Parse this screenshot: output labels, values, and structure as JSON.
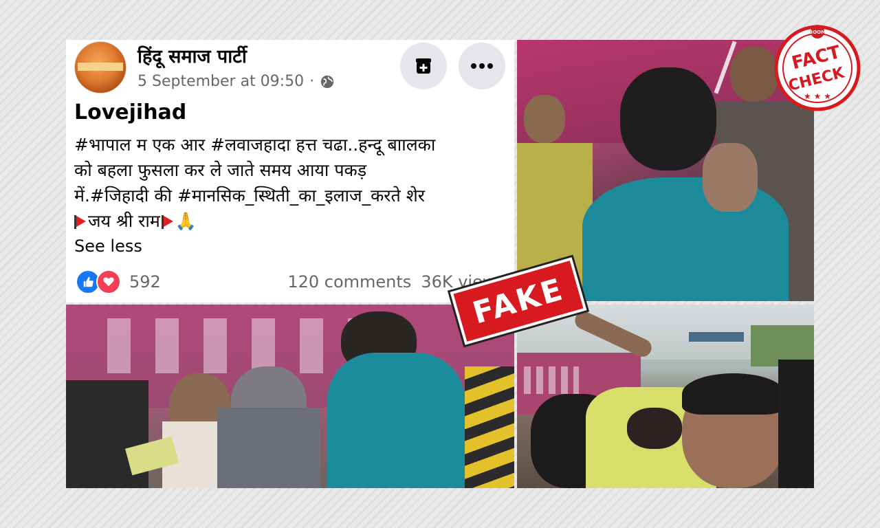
{
  "post": {
    "page_name": "हिंदू समाज पार्टी",
    "timestamp": "5 September at 09:50",
    "separator": "·",
    "title": "Lovejihad",
    "body_lines": [
      "#भापाल म एक आर #लवाजहादा हत्त चढा..हन्दू बाालका",
      "को बहला फुसला कर ले जाते समय आया पकड़",
      "में.#जिहादी की #मानसिक_स्थिती_का_इलाज_करते शेर",
      "जय श्री राम"
    ],
    "emoji_pray": "🙏",
    "see_less": "See less",
    "reaction_count": "592",
    "comments": "120 comments",
    "views": "36K views"
  },
  "icons": {
    "save": "save-icon",
    "more": "more-options-icon",
    "globe": "globe-icon",
    "like": "like-icon",
    "love": "love-icon",
    "flag": "saffron-flag-icon"
  },
  "overlay": {
    "fake_label": "FAKE",
    "seal_top": "BOOM",
    "seal_line1": "FACT",
    "seal_line2": "CHECK"
  },
  "colors": {
    "fb_blue": "#1877f2",
    "love_red": "#f33e58",
    "stamp_red": "#d71920",
    "meta_gray": "#65676b"
  }
}
